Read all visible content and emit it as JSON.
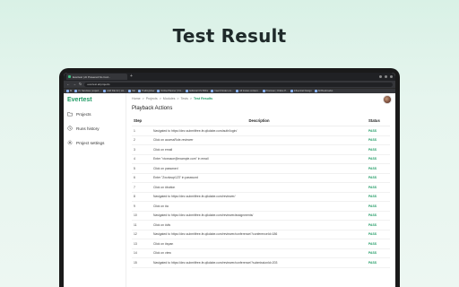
{
  "hero": {
    "title": "Test Result"
  },
  "browser": {
    "tab_title": "Evertest | AI Powered No Cod...",
    "url": "evertest.ai/projects",
    "bookmarks": [
      "M",
      "Vt. Services | experi...",
      "Add File for | Lin...",
      "Mo",
      "TradingView",
      "Online Planner | Fin...",
      "Editorial CS 500m",
      "Insert Finder em...",
      "All Insites context...",
      "Postman | Online P...",
      "Influential Design",
      "All Bookmarks"
    ]
  },
  "sidebar": {
    "logo": "Evertest",
    "items": [
      {
        "label": "Projects",
        "icon": "folder-icon"
      },
      {
        "label": "Runs history",
        "icon": "history-icon"
      },
      {
        "label": "Project settings",
        "icon": "gear-icon"
      }
    ]
  },
  "breadcrumb": [
    "Home",
    "Projects",
    "Modules",
    "Tests",
    "Test Results"
  ],
  "main": {
    "section_title": "Playback Actions"
  },
  "table": {
    "headers": {
      "step": "Step",
      "description": "Description",
      "status": "Status"
    },
    "rows": [
      {
        "step": "1",
        "description": "Navigated to https://dev-submitfree-fe.qikdabe.com/auth/login/",
        "status": "PASS"
      },
      {
        "step": "2",
        "description": "Click on accessRole-reviewer",
        "status": "PASS"
      },
      {
        "step": "3",
        "description": "Click on email",
        "status": "PASS"
      },
      {
        "step": "4",
        "description": "Enter \"vtonnace@example.com\" in email",
        "status": "PASS"
      },
      {
        "step": "5",
        "description": "Click on password",
        "status": "PASS"
      },
      {
        "step": "6",
        "description": "Enter \"Zxcdvsqr123\" in password",
        "status": "PASS"
      },
      {
        "step": "7",
        "description": "Click on #button",
        "status": "PASS"
      },
      {
        "step": "8",
        "description": "Navigated to https://dev-submitfree-fe.qikdabe.com/reviewer/",
        "status": "PASS"
      },
      {
        "step": "9",
        "description": "Click on #a",
        "status": "PASS"
      },
      {
        "step": "10",
        "description": "Navigated to https://dev-submitfree-fe.qikdabe.com/reviewer/assignments/",
        "status": "PASS"
      },
      {
        "step": "11",
        "description": "Click on #div",
        "status": "PASS"
      },
      {
        "step": "12",
        "description": "Navigated to https://dev-submitfree-fe.qikdabe.com/reviewer/conference/?conferenceId=186",
        "status": "PASS"
      },
      {
        "step": "13",
        "description": "Click on #span",
        "status": "PASS"
      },
      {
        "step": "14",
        "description": "Click on view",
        "status": "PASS"
      },
      {
        "step": "15",
        "description": "Navigated to https://dev-submitfree-fe.qikdabe.com/reviewer/conference/?submissionId=203",
        "status": "PASS"
      }
    ]
  },
  "colors": {
    "accent": "#1e9a63",
    "background": "#e3f4ec"
  }
}
